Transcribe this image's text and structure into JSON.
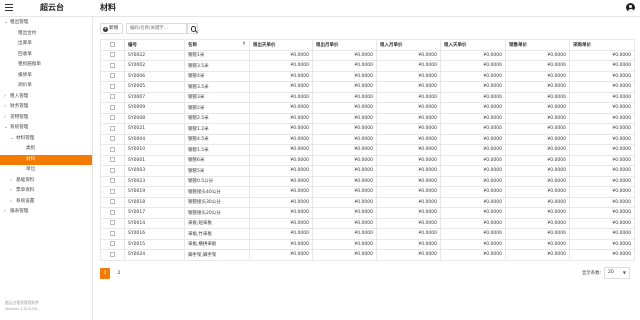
{
  "app_title": "超云台",
  "page_title": "材料",
  "sidebar": {
    "items": [
      {
        "label": "租出管理",
        "chev": "⌄",
        "indent": 0,
        "active": false
      },
      {
        "label": "租出合约",
        "chev": "",
        "indent": 2,
        "active": false
      },
      {
        "label": "出库单",
        "chev": "",
        "indent": 2,
        "active": false
      },
      {
        "label": "回收单",
        "chev": "",
        "indent": 2,
        "active": false
      },
      {
        "label": "租损赔偿单",
        "chev": "",
        "indent": 2,
        "active": false
      },
      {
        "label": "报修单",
        "chev": "",
        "indent": 2,
        "active": false
      },
      {
        "label": "调价单",
        "chev": "",
        "indent": 2,
        "active": false
      },
      {
        "label": "租入管理",
        "chev": "›",
        "indent": 0,
        "active": false
      },
      {
        "label": "财务管理",
        "chev": "›",
        "indent": 0,
        "active": false
      },
      {
        "label": "货物管理",
        "chev": "›",
        "indent": 0,
        "active": false
      },
      {
        "label": "系统管理",
        "chev": "⌄",
        "indent": 0,
        "active": false
      },
      {
        "label": "材料管理",
        "chev": "⌄",
        "indent": 1,
        "active": false
      },
      {
        "label": "类别",
        "chev": "",
        "indent": 3,
        "active": false
      },
      {
        "label": "材料",
        "chev": "",
        "indent": 3,
        "active": true
      },
      {
        "label": "单位",
        "chev": "",
        "indent": 3,
        "active": false
      },
      {
        "label": "基础资料",
        "chev": "›",
        "indent": 1,
        "active": false
      },
      {
        "label": "票单资料",
        "chev": "›",
        "indent": 1,
        "active": false
      },
      {
        "label": "系统设置",
        "chev": "›",
        "indent": 1,
        "active": false
      },
      {
        "label": "报表管理",
        "chev": "›",
        "indent": 0,
        "active": false
      }
    ],
    "footer_line1": "超云台租赁管理软件",
    "footer_line2": "Version 1.0.0(29)"
  },
  "toolbar": {
    "new_label": "新增",
    "search_placeholder": "编码/名称/关键字..."
  },
  "table": {
    "columns": [
      "编号",
      "名称",
      "租出天单价",
      "租出月单价",
      "租入月单价",
      "租入天单价",
      "销售单价",
      "采购单价"
    ],
    "rows": [
      [
        "SY0022",
        "钢管1米",
        "¥0.0000",
        "¥0.0000",
        "¥0.0000",
        "¥0.0000",
        "¥0.0000",
        "¥0.0000"
      ],
      [
        "SY0002",
        "钢管3.5米",
        "¥0.0000",
        "¥0.0000",
        "¥0.0000",
        "¥0.0000",
        "¥0.0000",
        "¥0.0000"
      ],
      [
        "SY0006",
        "钢管4米",
        "¥0.0000",
        "¥0.0000",
        "¥0.0000",
        "¥0.0000",
        "¥0.0000",
        "¥0.0000"
      ],
      [
        "SY0005",
        "钢管3.5米",
        "¥0.0000",
        "¥0.0000",
        "¥0.0000",
        "¥0.0000",
        "¥0.0000",
        "¥0.0000"
      ],
      [
        "SY0007",
        "钢管3米",
        "¥0.0000",
        "¥0.0000",
        "¥0.0000",
        "¥0.0000",
        "¥0.0000",
        "¥0.0000"
      ],
      [
        "SY0009",
        "钢管2米",
        "¥0.0000",
        "¥0.0000",
        "¥0.0000",
        "¥0.0000",
        "¥0.0000",
        "¥0.0000"
      ],
      [
        "SY0008",
        "钢管2.5米",
        "¥0.0000",
        "¥0.0000",
        "¥0.0000",
        "¥0.0000",
        "¥0.0000",
        "¥0.0000"
      ],
      [
        "SY0021",
        "钢管1.2米",
        "¥0.0000",
        "¥0.0000",
        "¥0.0000",
        "¥0.0000",
        "¥0.0000",
        "¥0.0000"
      ],
      [
        "SY0004",
        "钢管4.5米",
        "¥0.0000",
        "¥0.0000",
        "¥0.0000",
        "¥0.0000",
        "¥0.0000",
        "¥0.0000"
      ],
      [
        "SY0010",
        "钢管1.5米",
        "¥0.0000",
        "¥0.0000",
        "¥0.0000",
        "¥0.0000",
        "¥0.0000",
        "¥0.0000"
      ],
      [
        "SY0001",
        "钢管6米",
        "¥0.0000",
        "¥0.0000",
        "¥0.0000",
        "¥0.0000",
        "¥0.0000",
        "¥0.0000"
      ],
      [
        "SY0003",
        "钢管5米",
        "¥0.0000",
        "¥0.0000",
        "¥0.0000",
        "¥0.0000",
        "¥0.0000",
        "¥0.0000"
      ],
      [
        "SY0023",
        "钢管0.5公分",
        "¥0.0000",
        "¥0.0000",
        "¥0.0000",
        "¥0.0000",
        "¥0.0000",
        "¥0.0000"
      ],
      [
        "SY0019",
        "钢管接头40公分",
        "¥0.0000",
        "¥0.0000",
        "¥0.0000",
        "¥0.0000",
        "¥0.0000",
        "¥0.0000"
      ],
      [
        "SY0018",
        "钢管接头30公分",
        "¥0.0000",
        "¥0.0000",
        "¥0.0000",
        "¥0.0000",
        "¥0.0000",
        "¥0.0000"
      ],
      [
        "SY0017",
        "钢管接头20公分",
        "¥0.0000",
        "¥0.0000",
        "¥0.0000",
        "¥0.0000",
        "¥0.0000",
        "¥0.0000"
      ],
      [
        "SY0014",
        "采板,短采板",
        "¥0.0000",
        "¥0.0000",
        "¥0.0000",
        "¥0.0000",
        "¥0.0000",
        "¥0.0000"
      ],
      [
        "SY0016",
        "采板,竹采板",
        "¥0.0000",
        "¥0.0000",
        "¥0.0000",
        "¥0.0000",
        "¥0.0000",
        "¥0.0000"
      ],
      [
        "SY0015",
        "采板,横拼采板",
        "¥0.0000",
        "¥0.0000",
        "¥0.0000",
        "¥0.0000",
        "¥0.0000",
        "¥0.0000"
      ],
      [
        "SY0024",
        "脚手架,脚手架",
        "¥0.0000",
        "¥0.0000",
        "¥0.0000",
        "¥0.0000",
        "¥0.0000",
        "¥0.0000"
      ]
    ]
  },
  "pagination": {
    "pages": [
      "1",
      "2"
    ],
    "current": "1",
    "page_size_label": "显示条数:",
    "page_size": "20"
  },
  "colors": {
    "accent": "#f57a00"
  }
}
